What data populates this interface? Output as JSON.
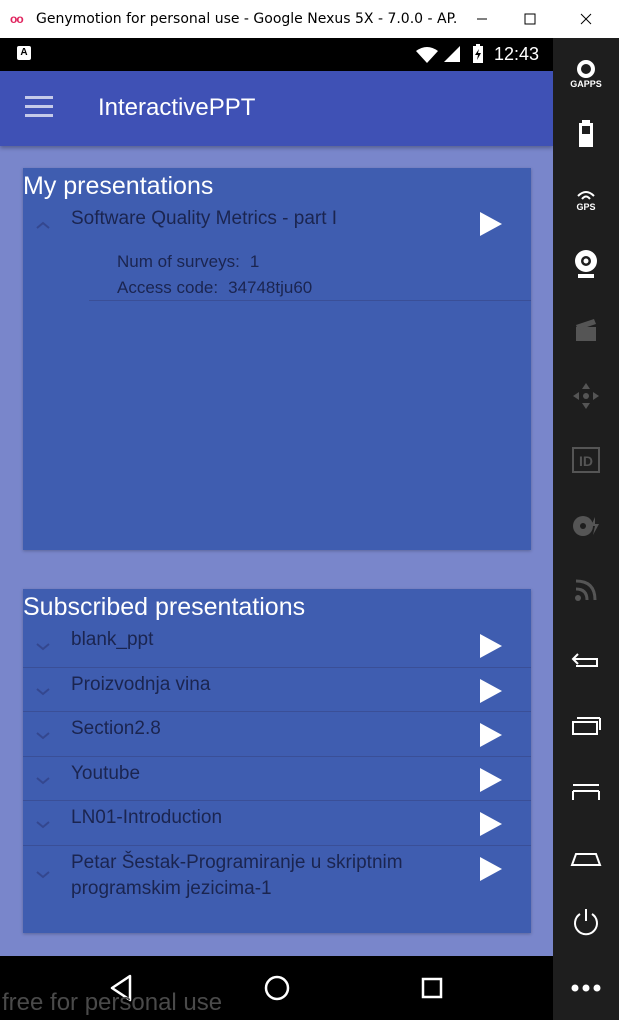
{
  "window": {
    "title": "Genymotion for personal use - Google Nexus 5X - 7.0.0 - AP..."
  },
  "statusbar": {
    "notification_icon_letter": "A",
    "time": "12:43"
  },
  "appbar": {
    "title": "InteractivePPT"
  },
  "my_presentations": {
    "heading": "My presentations",
    "items": [
      {
        "name": "Software Quality Metrics - part I",
        "expanded": true,
        "num_surveys_label": "Num of surveys:",
        "num_surveys_value": "1",
        "access_code_label": "Access code:",
        "access_code_value": "34748tju60"
      }
    ]
  },
  "subscribed_presentations": {
    "heading": "Subscribed presentations",
    "items": [
      {
        "name": "blank_ppt"
      },
      {
        "name": "Proizvodnja vina"
      },
      {
        "name": "Section2.8"
      },
      {
        "name": "Youtube"
      },
      {
        "name": "LN01-Introduction"
      },
      {
        "name_line1": "Petar Šestak-Programiranje u skriptnim",
        "name_line2": "programskim jezicima-1"
      }
    ]
  },
  "sidebar": {
    "gapps_label": "GAPPS",
    "gps_label": "GPS",
    "id_label": "ID"
  },
  "watermark": "free for personal use",
  "colors": {
    "app_bar": "#3f51b5",
    "background": "#7986cb",
    "card": "#3f5db0",
    "item_text": "#1b2550"
  }
}
